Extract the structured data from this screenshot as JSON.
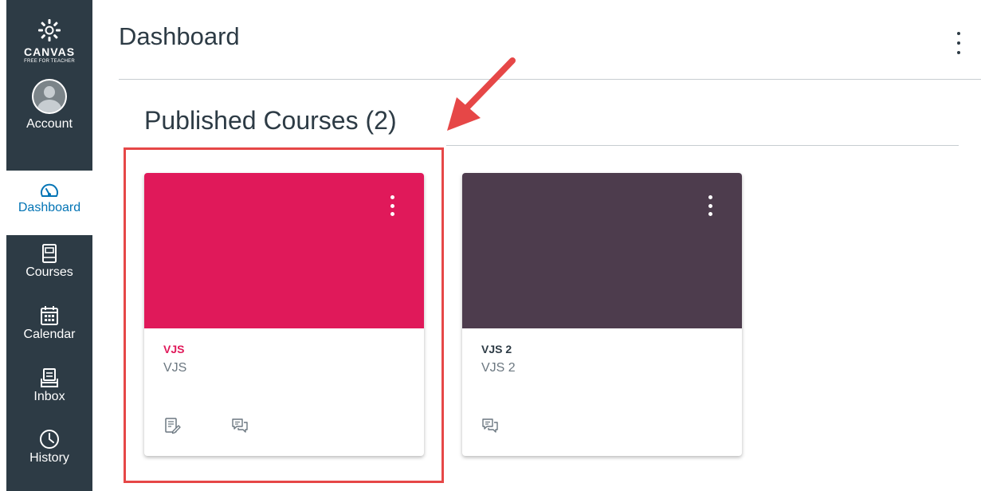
{
  "app": {
    "logo_word": "CANVAS",
    "logo_sub": "FREE FOR TEACHER"
  },
  "nav": {
    "account": "Account",
    "dashboard": "Dashboard",
    "courses": "Courses",
    "calendar": "Calendar",
    "inbox": "Inbox",
    "history": "History"
  },
  "page": {
    "title": "Dashboard",
    "section_title": "Published Courses (2)"
  },
  "courses": [
    {
      "title": "VJS",
      "subtitle": "VJS",
      "color": "#e0195a",
      "title_color": "#e0195a",
      "icons": [
        "assignments-icon",
        "discussions-icon"
      ]
    },
    {
      "title": "VJS 2",
      "subtitle": "VJS 2",
      "color": "#4d3c4d",
      "title_color": "#2d3b45",
      "icons": [
        "discussions-icon"
      ]
    }
  ],
  "colors": {
    "nav_bg": "#2d3b45",
    "active_blue": "#0374b5",
    "annotation_red": "#e64747"
  }
}
